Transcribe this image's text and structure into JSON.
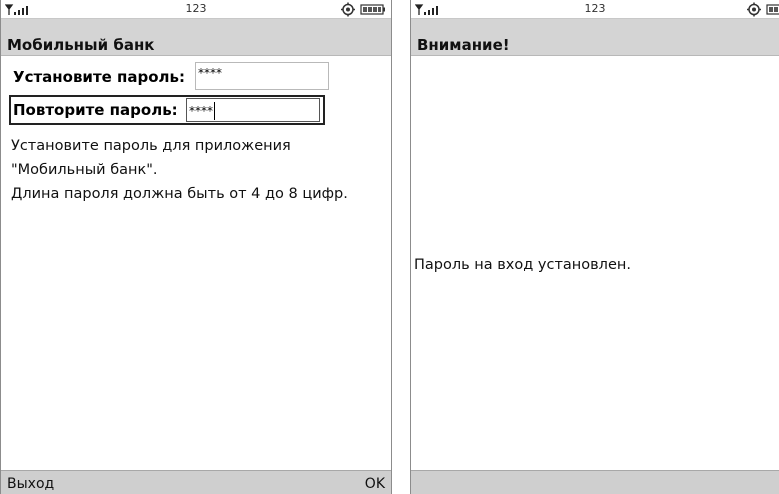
{
  "left_screen": {
    "status_bar": {
      "clock": "123",
      "signal_icon": "signal-strength-icon",
      "settings_icon": "gear-icon",
      "battery_icon": "battery-icon"
    },
    "title": "Мобильный банк",
    "form": {
      "set_password_label": "Установите пароль:",
      "set_password_value": "****",
      "repeat_password_label": "Повторите пароль:",
      "repeat_password_value": "****"
    },
    "hint_lines": [
      "Установите пароль для приложения",
      "\"Мобильный банк\".",
      "Длина пароля должна быть от 4 до 8 цифр."
    ],
    "softkeys": {
      "left": "Выход",
      "right": "OK"
    }
  },
  "right_screen": {
    "status_bar": {
      "clock": "123",
      "signal_icon": "signal-strength-icon",
      "settings_icon": "gear-icon",
      "battery_icon": "battery-icon"
    },
    "title": "Внимание!",
    "message": "Пароль на вход установлен."
  },
  "colors": {
    "titlebar_bg": "#d4d4d4",
    "softbar_bg": "#cfcfcf",
    "screen_bg": "#ffffff"
  }
}
